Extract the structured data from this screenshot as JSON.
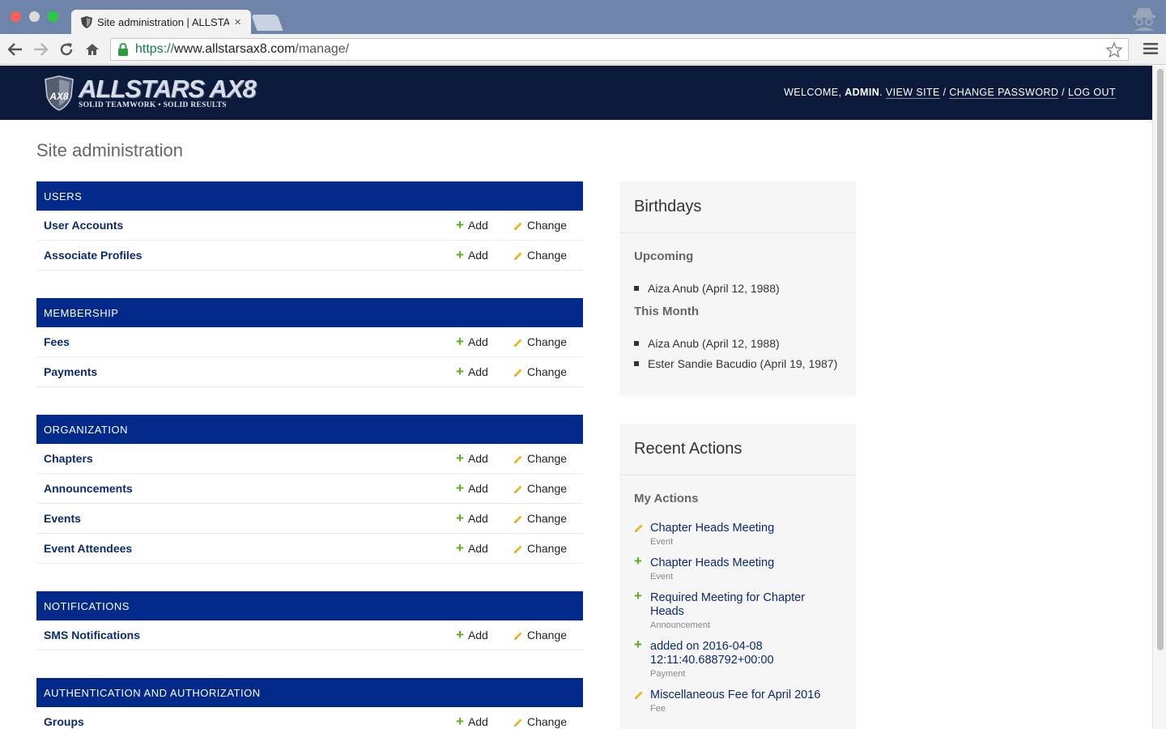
{
  "browser": {
    "tab_title": "Site administration | ALLSTARS AX8",
    "tab_close": "×",
    "url_scheme": "https://",
    "url_host": "www.allstarsax8.com",
    "url_path": "/manage/"
  },
  "header": {
    "logo_main": "ALLSTARS AX8",
    "logo_tagline": "SOLID TEAMWORK • SOLID RESULTS",
    "welcome": "WELCOME, ",
    "username": "ADMIN",
    "sep_dot": ". ",
    "view_site": "VIEW SITE",
    "sep1": " / ",
    "change_password": "CHANGE PASSWORD",
    "sep2": " / ",
    "log_out": "LOG OUT"
  },
  "page_title": "Site administration",
  "actions_labels": {
    "add": "Add",
    "change": "Change"
  },
  "modules": [
    {
      "caption": "USERS",
      "rows": [
        "User Accounts",
        "Associate Profiles"
      ]
    },
    {
      "caption": "MEMBERSHIP",
      "rows": [
        "Fees",
        "Payments"
      ]
    },
    {
      "caption": "ORGANIZATION",
      "rows": [
        "Chapters",
        "Announcements",
        "Events",
        "Event Attendees"
      ]
    },
    {
      "caption": "NOTIFICATIONS",
      "rows": [
        "SMS Notifications"
      ]
    },
    {
      "caption": "AUTHENTICATION AND AUTHORIZATION",
      "rows": [
        "Groups"
      ]
    }
  ],
  "birthdays": {
    "title": "Birthdays",
    "upcoming_label": "Upcoming",
    "upcoming": [
      "Aiza Anub (April 12, 1988)"
    ],
    "this_month_label": "This Month",
    "this_month": [
      "Aiza Anub (April 12, 1988)",
      "Ester Sandie Bacudio (April 19, 1987)"
    ]
  },
  "recent_actions": {
    "title": "Recent Actions",
    "my_actions_label": "My Actions",
    "items": [
      {
        "icon": "pencil-icon",
        "title": "Chapter Heads Meeting",
        "type": "Event"
      },
      {
        "icon": "plus-icon",
        "title": "Chapter Heads Meeting",
        "type": "Event"
      },
      {
        "icon": "plus-icon",
        "title": "Required Meeting for Chapter Heads",
        "type": "Announcement"
      },
      {
        "icon": "plus-icon",
        "title": "added on 2016-04-08 12:11:40.688792+00:00",
        "type": "Payment"
      },
      {
        "icon": "pencil-icon",
        "title": "Miscellaneous Fee for April 2016",
        "type": "Fee"
      }
    ]
  },
  "colors": {
    "header_bg": "#0c1a3b",
    "module_caption_bg": "#00298a",
    "link": "#0c2a6e",
    "add_green": "#5aaa22",
    "change_yellow": "#e8b820"
  }
}
